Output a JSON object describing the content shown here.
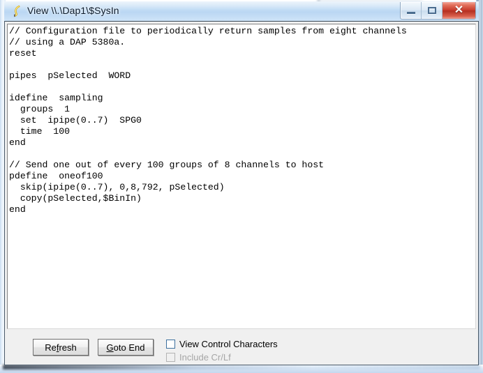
{
  "window": {
    "title": "View \\\\.\\Dap1\\$SysIn",
    "icon": "hook-icon"
  },
  "caption_buttons": {
    "minimize": {
      "name": "minimize-button",
      "glyph": "minimize-icon"
    },
    "maximize": {
      "name": "maximize-button",
      "glyph": "maximize-icon"
    },
    "close": {
      "name": "close-button",
      "glyph": "close-icon",
      "label": "✕"
    }
  },
  "editor": {
    "text": "// Configuration file to periodically return samples from eight channels\n// using a DAP 5380a.\nreset\n\npipes  pSelected  WORD\n\nidefine  sampling\n  groups  1\n  set  ipipe(0..7)  SPG0\n  time  100\nend\n\n// Send one out of every 100 groups of 8 channels to host\npdefine  oneof100\n  skip(ipipe(0..7), 0,8,792, pSelected)\n  copy(pSelected,$BinIn)\nend",
    "lines": [
      "// Configuration file to periodically return samples from eight channels",
      "// using a DAP 5380a.",
      "reset",
      "",
      "pipes  pSelected  WORD",
      "",
      "idefine  sampling",
      "  groups  1",
      "  set  ipipe(0..7)  SPG0",
      "  time  100",
      "end",
      "",
      "// Send one out of every 100 groups of 8 channels to host",
      "pdefine  oneof100",
      "  skip(ipipe(0..7), 0,8,792, pSelected)",
      "  copy(pSelected,$BinIn)",
      "end"
    ]
  },
  "controls": {
    "refresh": {
      "prefix": "Re",
      "mnemonic": "f",
      "suffix": "resh"
    },
    "goto_end": {
      "prefix": "",
      "mnemonic": "G",
      "suffix": "oto End"
    },
    "view_control_characters": {
      "label": "View Control Characters",
      "checked": false,
      "enabled": true
    },
    "include_crlf": {
      "label": "Include Cr/Lf",
      "checked": false,
      "enabled": false
    }
  },
  "colors": {
    "titlebar_glass": "#c3ddf5",
    "close_button_red": "#c6382a",
    "client_background": "#f0f0f0",
    "editor_background": "#ffffff",
    "editor_text": "#000000",
    "disabled_text": "#a6a6a6"
  }
}
